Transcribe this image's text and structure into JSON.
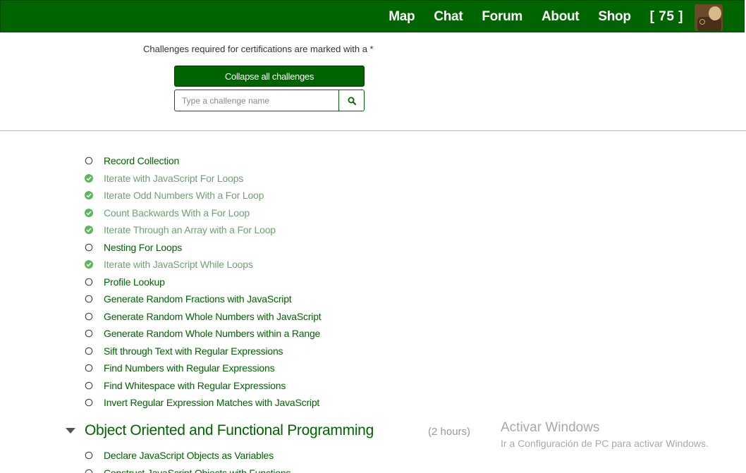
{
  "nav": {
    "links": [
      "Map",
      "Chat",
      "Forum",
      "About",
      "Shop"
    ],
    "points": "[ 75 ]",
    "background": "#006400"
  },
  "cert_note": "Challenges required for certifications are marked with a *",
  "collapse_label": "Collapse all challenges",
  "search": {
    "placeholder": "Type a challenge name",
    "value": "",
    "icon": "search-icon"
  },
  "challenges": [
    {
      "name": "Record Collection",
      "done": false
    },
    {
      "name": "Iterate with JavaScript For Loops",
      "done": true
    },
    {
      "name": "Iterate Odd Numbers With a For Loop",
      "done": true
    },
    {
      "name": "Count Backwards With a For Loop",
      "done": true
    },
    {
      "name": "Iterate Through an Array with a For Loop",
      "done": true
    },
    {
      "name": "Nesting For Loops",
      "done": false
    },
    {
      "name": "Iterate with JavaScript While Loops",
      "done": true
    },
    {
      "name": "Profile Lookup",
      "done": false
    },
    {
      "name": "Generate Random Fractions with JavaScript",
      "done": false
    },
    {
      "name": "Generate Random Whole Numbers with JavaScript",
      "done": false
    },
    {
      "name": "Generate Random Whole Numbers within a Range",
      "done": false
    },
    {
      "name": "Sift through Text with Regular Expressions",
      "done": false
    },
    {
      "name": "Find Numbers with Regular Expressions",
      "done": false
    },
    {
      "name": "Find Whitespace with Regular Expressions",
      "done": false
    },
    {
      "name": "Invert Regular Expression Matches with JavaScript",
      "done": false
    }
  ],
  "section": {
    "title": "Object Oriented and Functional Programming",
    "time": "(2 hours)",
    "challenges": [
      {
        "name": "Declare JavaScript Objects as Variables",
        "done": false
      },
      {
        "name": "Construct JavaScript Objects with Functions",
        "done": false
      }
    ]
  },
  "watermark": {
    "title": "Activar Windows",
    "subtitle": "Ir a Configuración de PC para activar Windows."
  },
  "colors": {
    "accent": "#006400",
    "done": "#6f9f76",
    "done_icon": "#5cb85c"
  }
}
